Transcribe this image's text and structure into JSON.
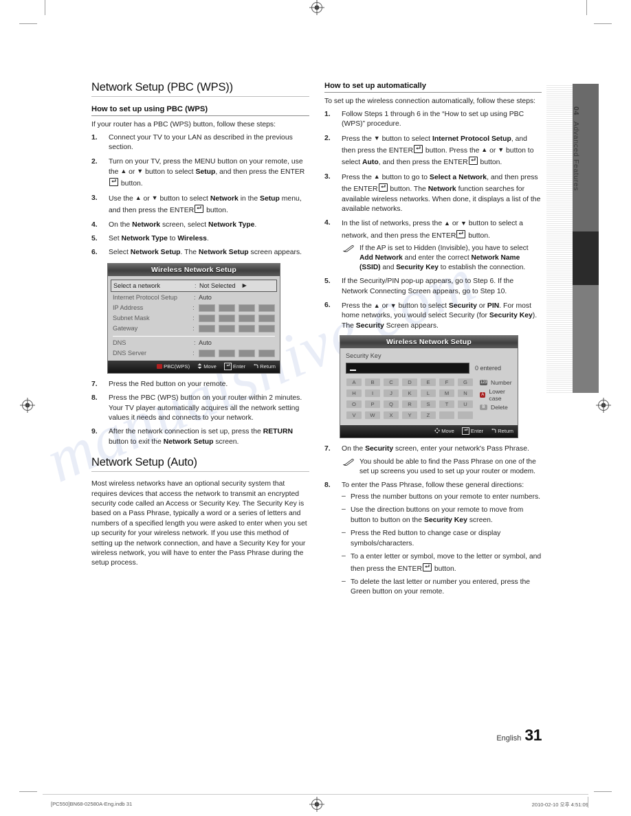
{
  "side_tab": {
    "number": "04",
    "label": "Advanced Features"
  },
  "left_column": {
    "heading": "Network Setup (PBC (WPS))",
    "subheading": "How to set up using PBC (WPS)",
    "intro": "If your router has a PBC (WPS) button, follow these steps:",
    "steps": [
      {
        "num": "1.",
        "text": "Connect your TV to your LAN as described in the previous section."
      },
      {
        "num": "2.",
        "text": "Turn on your TV, press the MENU button on your remote, use the ▲ or ▼ button to select Setup, and then press the ENTER button."
      },
      {
        "num": "3.",
        "text": "Use the ▲ or ▼ button to select Network in the Setup menu, and then press the ENTER button."
      },
      {
        "num": "4.",
        "text": "On the Network screen, select Network Type."
      },
      {
        "num": "5.",
        "text": "Set Network Type to Wireless."
      },
      {
        "num": "6.",
        "text": "Select Network Setup. The Network Setup screen appears."
      }
    ],
    "steps_after": [
      {
        "num": "7.",
        "text": "Press the Red button on your remote."
      },
      {
        "num": "8.",
        "text": "Press the PBC (WPS) button on your router within 2 minutes. Your TV player automatically acquires all the network setting values it needs and connects to your network."
      },
      {
        "num": "9.",
        "text": "After the network connection is set up, press the RETURN button to exit the Network Setup screen."
      }
    ],
    "heading2": "Network Setup (Auto)",
    "body2": "Most wireless networks have an optional security system that requires devices that access the network to transmit an encrypted security code called an Access or Security Key. The Security Key is based on a Pass Phrase, typically a word or a series of letters and numbers of a specified length you were asked to enter when you set up security for your wireless network.  If you use this method of setting up the network connection, and have a Security Key for your wireless network, you will have to enter the Pass Phrase during the setup process."
  },
  "screen_network": {
    "title": "Wireless Network Setup",
    "rows": [
      {
        "label": "Select a network",
        "sep": ":",
        "value": "Not Selected",
        "selected": true,
        "caret": "▶"
      },
      {
        "label": "Internet Protocol Setup",
        "sep": ":",
        "value": "Auto"
      },
      {
        "label": "IP Address",
        "sep": ":",
        "value": "",
        "octets": 4
      },
      {
        "label": "Subnet Mask",
        "sep": ":",
        "value": "",
        "octets": 4
      },
      {
        "label": "Gateway",
        "sep": ":",
        "value": "",
        "octets": 4
      },
      {
        "label": "DNS",
        "sep": ":",
        "value": "Auto",
        "divider_before": true
      },
      {
        "label": "DNS Server",
        "sep": ":",
        "value": "",
        "octets": 4
      }
    ],
    "footer": [
      "PBC(WPS)",
      "Move",
      "Enter",
      "Return"
    ]
  },
  "screen_security": {
    "title": "Wireless Network Setup",
    "field_label": "Security Key",
    "field_value": "",
    "entered_text": "0 entered",
    "keyboard_rows": [
      [
        "A",
        "B",
        "C",
        "D",
        "E",
        "F",
        "G"
      ],
      [
        "H",
        "I",
        "J",
        "K",
        "L",
        "M",
        "N"
      ],
      [
        "O",
        "P",
        "Q",
        "R",
        "S",
        "T",
        "U"
      ],
      [
        "V",
        "W",
        "X",
        "Y",
        "Z",
        "",
        ""
      ]
    ],
    "legend": [
      {
        "chip": "number-chip",
        "label": "Number"
      },
      {
        "chip": "red-chip",
        "label": "Lower case"
      },
      {
        "chip": "green-chip",
        "label": "Delete"
      }
    ],
    "footer": [
      "Move",
      "Enter",
      "Return"
    ]
  },
  "right_column": {
    "subheading": "How to set up automatically",
    "intro": "To set up the wireless connection automatically, follow these steps:",
    "steps": [
      {
        "num": "1.",
        "text": "Follow Steps 1 through 6 in the “How to set up using PBC (WPS)” procedure."
      },
      {
        "num": "2.",
        "text": "Press the ▼ button to select Internet Protocol Setup, and then press the ENTER button. Press the ▲ or ▼ button to select Auto, and then press the ENTER button."
      },
      {
        "num": "3.",
        "text": "Press the ▲ button to go to Select a Network, and then press the ENTER button. The Network function searches for available wireless networks. When done, it displays a list of the available networks."
      },
      {
        "num": "4.",
        "text": "In the list of networks, press the ▲ or ▼ button to select a network, and then press the ENTER button."
      }
    ],
    "note1": "If the AP is set to Hidden (Invisible), you have to select Add Network and enter the correct Network Name (SSID) and Security Key to establish the connection.",
    "steps2": [
      {
        "num": "5.",
        "text": "If the Security/PIN pop-up appears, go to Step 6. If the Network Connecting Screen appears, go to Step 10."
      },
      {
        "num": "6.",
        "text": "Press the ▲ or ▼ button to select Security or PIN. For most home networks, you would select Security (for Security Key). The Security Screen appears."
      }
    ],
    "step7": {
      "num": "7.",
      "text": "On the Security screen, enter your network's Pass Phrase."
    },
    "note2": "You should be able to find the Pass Phrase on one of the set up screens you used to set up your router or modem.",
    "step8": {
      "num": "8.",
      "text": "To enter the Pass Phrase, follow these general directions:"
    },
    "bullets": [
      "Press the number buttons on your remote to enter numbers.",
      "Use the direction buttons on your remote to move from button to button on the Security Key screen.",
      "Press the Red button to change case or display symbols/characters.",
      "To a enter letter or symbol, move to the letter or symbol, and then press the ENTER button.",
      "To delete the last letter or number you entered, press the Green button on your remote."
    ]
  },
  "page_footer": {
    "language": "English",
    "page_number": "31",
    "file_name": "[PC550]BN68-02580A-Eng.indb  31",
    "timestamp": "2010-02-10   오후 4:51:09"
  }
}
